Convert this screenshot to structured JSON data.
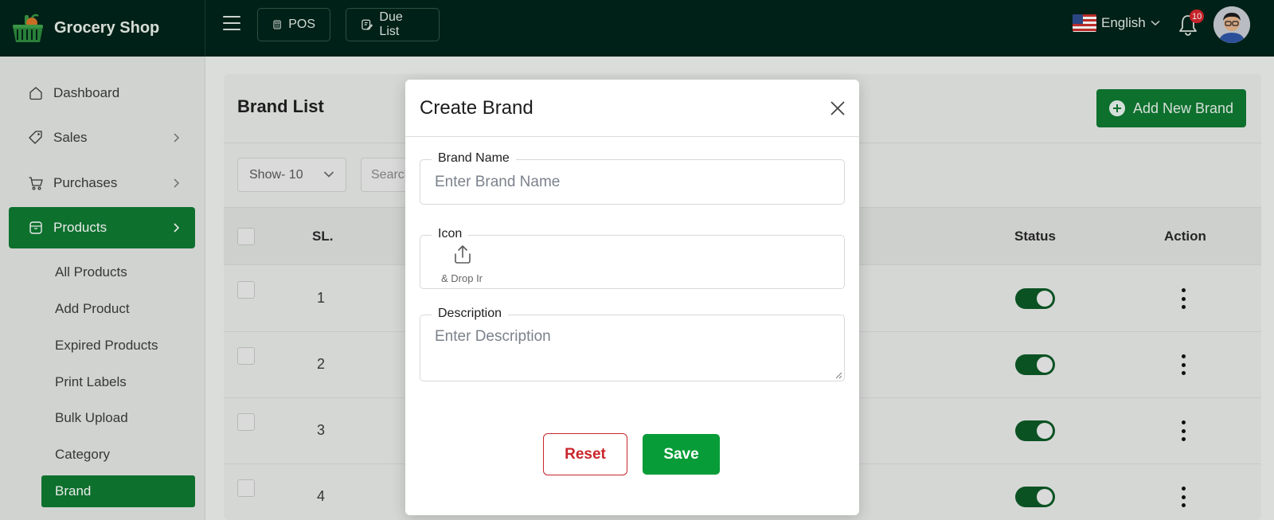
{
  "app": {
    "name": "Grocery Shop",
    "top_buttons": [
      {
        "label": "POS",
        "icon": "calculator-icon"
      },
      {
        "label": "Due List",
        "icon": "clipboard-edit-icon"
      }
    ],
    "language": "English",
    "notifications_count": "10"
  },
  "sidebar": {
    "items": [
      {
        "label": "Dashboard",
        "icon": "dashboard-icon"
      },
      {
        "label": "Sales",
        "icon": "tag-icon"
      },
      {
        "label": "Purchases",
        "icon": "cart-icon"
      },
      {
        "label": "Products",
        "icon": "box-icon"
      }
    ],
    "product_sub_items": [
      "All Products",
      "Add Product",
      "Expired Products",
      "Print Labels",
      "Bulk Upload",
      "Category",
      "Brand"
    ]
  },
  "page": {
    "title": "Brand List",
    "add_button": "Add New Brand",
    "show_select": "Show- 10",
    "search_placeholder": "Search",
    "columns": {
      "sl": "SL.",
      "status": "Status",
      "action": "Action"
    },
    "rows": [
      {
        "sl": "1",
        "status": "on"
      },
      {
        "sl": "2",
        "status": "on"
      },
      {
        "sl": "3",
        "status": "on"
      },
      {
        "sl": "4",
        "status": "on"
      }
    ]
  },
  "modal": {
    "title": "Create Brand",
    "brand_name_label": "Brand Name",
    "brand_name_placeholder": "Enter Brand Name",
    "icon_label": "Icon",
    "upload_text": "& Drop Ir",
    "description_label": "Description",
    "description_placeholder": "Enter Description",
    "reset_label": "Reset",
    "save_label": "Save"
  },
  "colors": {
    "primary_green": "#0f7a31",
    "save_green": "#079c38",
    "topbar": "#00241a",
    "reset_red": "#c9252b",
    "badge_red": "#d7262d"
  }
}
